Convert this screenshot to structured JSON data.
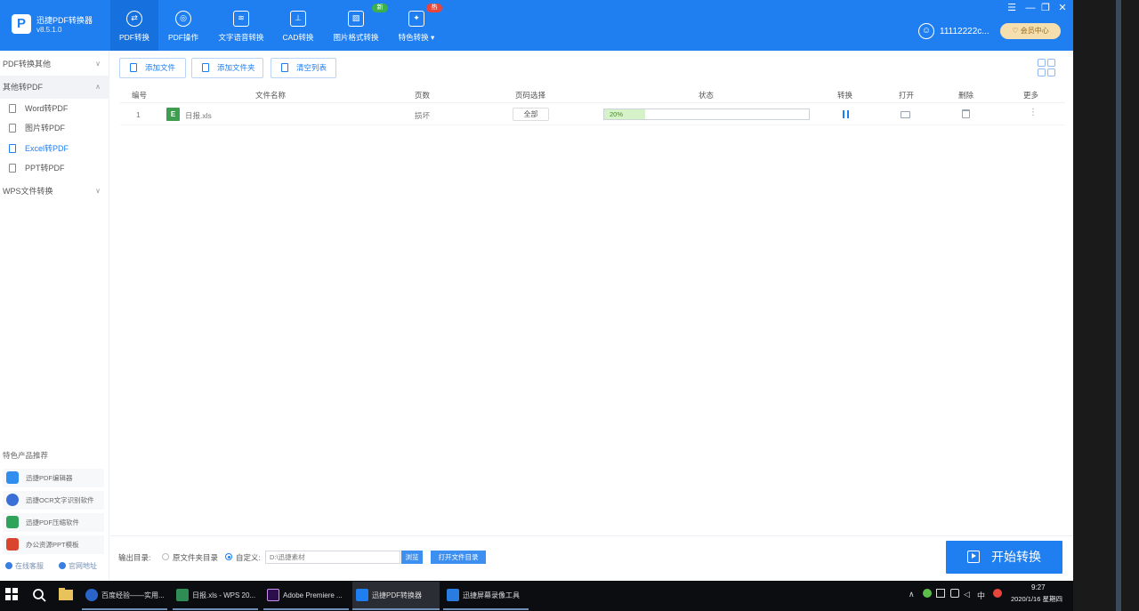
{
  "app": {
    "name": "迅捷PDF转换器",
    "version": "v8.5.1.0",
    "logo_letter": "P"
  },
  "nav": {
    "tabs": [
      {
        "label": "PDF转换",
        "icon": "pdf-convert-icon",
        "glyph": "⇄"
      },
      {
        "label": "PDF操作",
        "icon": "pdf-operate-icon",
        "glyph": "◎"
      },
      {
        "label": "文字语音转换",
        "icon": "voice-icon",
        "glyph": "≋"
      },
      {
        "label": "CAD转换",
        "icon": "cad-icon",
        "glyph": "⊥"
      },
      {
        "label": "图片格式转换",
        "icon": "image-icon",
        "glyph": "▨"
      },
      {
        "label": "特色转换 ▾",
        "icon": "feature-icon",
        "glyph": "✦"
      }
    ],
    "badges": {
      "new": "新",
      "hot": "热"
    }
  },
  "user": {
    "name": "11112222c...",
    "member_button": "♡ 会员中心"
  },
  "window_controls": {
    "menu": "☰",
    "minimize": "—",
    "restore": "❐",
    "close": "✕"
  },
  "sidebar": {
    "groups": [
      {
        "label": "PDF转换其他",
        "chevron": "∨"
      },
      {
        "label": "其他转PDF",
        "chevron": "∧"
      },
      {
        "label": "WPS文件转换",
        "chevron": "∨"
      }
    ],
    "items": [
      {
        "label": "Word转PDF"
      },
      {
        "label": "图片转PDF"
      },
      {
        "label": "Excel转PDF"
      },
      {
        "label": "PPT转PDF"
      }
    ],
    "promo_title": "特色产品推荐",
    "promos": [
      {
        "label": "迅捷PDF编辑器",
        "color": "#2f8ef0"
      },
      {
        "label": "迅捷OCR文字识别软件",
        "color": "#3a6fd8"
      },
      {
        "label": "迅捷PDF压缩软件",
        "color": "#2fa35a"
      },
      {
        "label": "办公资源PPT模板",
        "color": "#d9452f"
      }
    ],
    "footer": {
      "service": "在线客服",
      "website": "官网地址"
    }
  },
  "toolbar": {
    "add_file": "添加文件",
    "add_folder": "添加文件夹",
    "clear_list": "清空列表"
  },
  "table": {
    "headers": [
      "编号",
      "文件名称",
      "页数",
      "页码选择",
      "状态",
      "转换",
      "打开",
      "删除",
      "更多"
    ],
    "rows": [
      {
        "index": "1",
        "file_icon": "E",
        "file_name": "日报.xls",
        "pages": "损坏",
        "page_select": "全部",
        "progress_text": "20%",
        "progress": 0.2,
        "more": "⋮"
      }
    ]
  },
  "output": {
    "label": "输出目录:",
    "option_original": "原文件夹目录",
    "option_custom": "自定义:",
    "path_placeholder": "D:\\迅捷素材",
    "browse": "浏览",
    "open_dir": "打开文件目录"
  },
  "start_button": "开始转换",
  "taskbar": {
    "apps": [
      {
        "label": "百度经验——实用...",
        "color": "#2a64c8"
      },
      {
        "label": "日报.xls - WPS 20...",
        "color": "#2f8c55"
      },
      {
        "label": "Adobe Premiere ...",
        "color": "#2c0e4a"
      },
      {
        "label": "迅捷PDF转换器",
        "color": "#1f7ff0"
      },
      {
        "label": "迅捷屏幕录像工具",
        "color": "#2a7de0"
      }
    ],
    "tray": {
      "caret": "∧",
      "ime": "中",
      "clock_time": "9:27",
      "clock_date": "2020/1/16 星期四"
    }
  }
}
